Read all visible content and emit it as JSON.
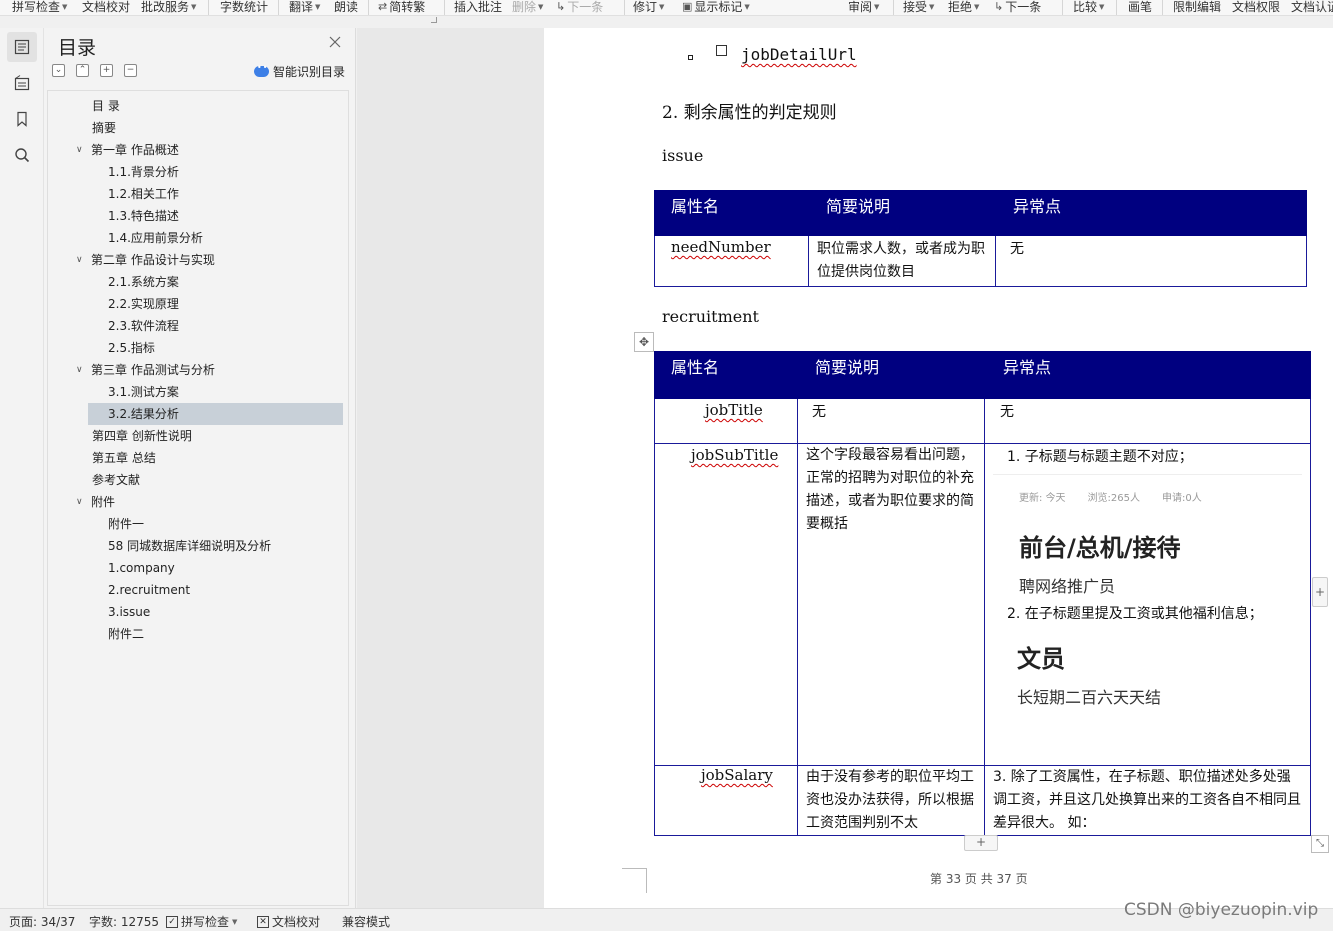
{
  "toolbar": {
    "items": [
      {
        "label": "拼写检查",
        "caret": true
      },
      {
        "label": "文档校对"
      },
      {
        "label": "批改服务",
        "caret": true
      },
      {
        "label": "字数统计"
      },
      {
        "label": "翻译",
        "caret": true
      },
      {
        "label": "朗读"
      },
      {
        "label": "简转繁"
      },
      {
        "label": "插入批注"
      },
      {
        "label": "删除",
        "caret": true
      },
      {
        "label": "下一条"
      },
      {
        "label": "修订",
        "caret": true
      },
      {
        "label": "显示标记",
        "caret": true
      },
      {
        "label": "审阅",
        "caret": true
      },
      {
        "label": "接受",
        "caret": true
      },
      {
        "label": "拒绝",
        "caret": true
      },
      {
        "label": "下一条"
      },
      {
        "label": "比较",
        "caret": true
      },
      {
        "label": "画笔"
      },
      {
        "label": "限制编辑"
      },
      {
        "label": "文档权限"
      },
      {
        "label": "文档认证"
      }
    ]
  },
  "rail": {
    "icons": [
      "toc-icon",
      "outline-icon",
      "bookmark-icon",
      "search-icon"
    ]
  },
  "toc": {
    "title": "目录",
    "smart_label": "智能识别目录",
    "items": [
      {
        "label": "目 录"
      },
      {
        "label": "摘要"
      },
      {
        "label": "第一章 作品概述",
        "expanded": true
      },
      {
        "label": "1.1.背景分析"
      },
      {
        "label": "1.2.相关工作"
      },
      {
        "label": "1.3.特色描述"
      },
      {
        "label": "1.4.应用前景分析"
      },
      {
        "label": "第二章 作品设计与实现",
        "expanded": true
      },
      {
        "label": "2.1.系统方案"
      },
      {
        "label": "2.2.实现原理"
      },
      {
        "label": "2.3.软件流程"
      },
      {
        "label": "2.5.指标"
      },
      {
        "label": "第三章 作品测试与分析",
        "expanded": true
      },
      {
        "label": "3.1.测试方案"
      },
      {
        "label": "3.2.结果分析",
        "selected": true
      },
      {
        "label": "第四章 创新性说明"
      },
      {
        "label": "第五章 总结"
      },
      {
        "label": "参考文献"
      },
      {
        "label": "附件",
        "expanded": true
      },
      {
        "label": "附件一"
      },
      {
        "label": "58 同城数据库详细说明及分析"
      },
      {
        "label": "1.company"
      },
      {
        "label": "2.recruitment"
      },
      {
        "label": "3.issue"
      },
      {
        "label": "附件二"
      }
    ]
  },
  "document": {
    "bullet_field": "jobDetailUrl",
    "section_heading": "2. 剩余属性的判定规则",
    "issue_label": "issue",
    "recruitment_label": "recruitment",
    "table_headers": [
      "属性名",
      "简要说明",
      "异常点"
    ],
    "issue_table": [
      {
        "name": "needNumber",
        "desc": "职位需求人数，或者成为职位提供岗位数目",
        "anomaly": "无"
      }
    ],
    "recruitment_table": {
      "row1": {
        "name": "jobTitle",
        "desc": "无",
        "anomaly": "无"
      },
      "row2": {
        "name": "jobSubTitle",
        "desc": "这个字段最容易看出问题，正常的招聘为对职位的补充描述，或者为职位要求的简要概括",
        "anomaly_point1": "1. 子标题与标题主题不对应；",
        "card1": {
          "meta": [
            "更新: 今天",
            "浏览:265人",
            "申请:0人"
          ],
          "title": "前台/总机/接待",
          "subtitle": "聘网络推广员"
        },
        "anomaly_point2": "2. 在子标题里提及工资或其他福利信息；",
        "card2": {
          "title": "文员",
          "subtitle": "长短期二百六天天结"
        }
      },
      "row3": {
        "name": "jobSalary",
        "desc": "由于没有参考的职位平均工资也没办法获得，所以根据工资范围判别不太",
        "anomaly": "3. 除了工资属性，在子标题、职位描述处多处强调工资，并且这几处换算出来的工资各自不相同且差异很大。 如："
      }
    },
    "footer": "第 33 页 共 37 页"
  },
  "statusbar": {
    "page": "页面: 34/37",
    "words": "字数: 12755",
    "spell": "拼写检查",
    "proof": "文档校对",
    "mode": "兼容模式"
  },
  "watermark": "CSDN @biyezuopin.vip"
}
